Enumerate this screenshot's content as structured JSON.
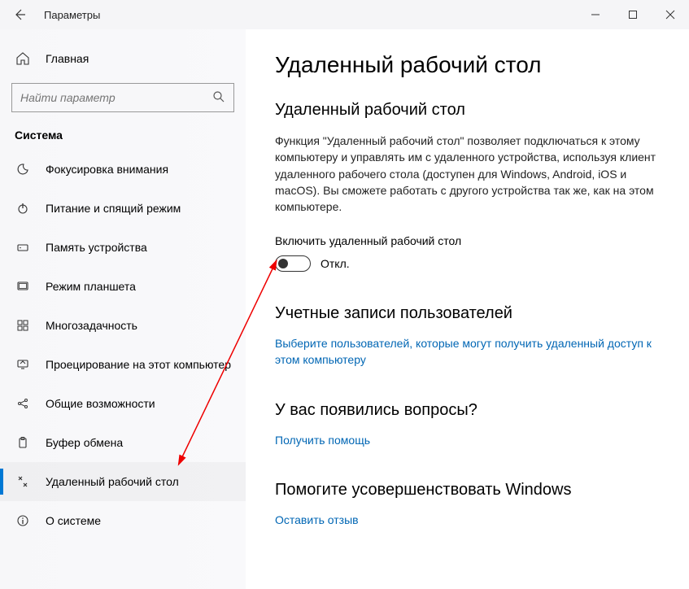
{
  "titlebar": {
    "title": "Параметры"
  },
  "sidebar": {
    "home_label": "Главная",
    "search_placeholder": "Найти параметр",
    "category": "Система",
    "items": [
      {
        "label": "Фокусировка внимания",
        "icon": "moon-icon"
      },
      {
        "label": "Питание и спящий режим",
        "icon": "power-icon"
      },
      {
        "label": "Память устройства",
        "icon": "storage-icon"
      },
      {
        "label": "Режим планшета",
        "icon": "tablet-icon"
      },
      {
        "label": "Многозадачность",
        "icon": "multitask-icon"
      },
      {
        "label": "Проецирование на этот компьютер",
        "icon": "project-icon"
      },
      {
        "label": "Общие возможности",
        "icon": "shared-icon"
      },
      {
        "label": "Буфер обмена",
        "icon": "clipboard-icon"
      },
      {
        "label": "Удаленный рабочий стол",
        "icon": "remote-desktop-icon",
        "selected": true
      },
      {
        "label": "О системе",
        "icon": "info-icon"
      }
    ]
  },
  "main": {
    "page_title": "Удаленный рабочий стол",
    "section_title": "Удаленный рабочий стол",
    "description": "Функция \"Удаленный рабочий стол\" позволяет подключаться к этому компьютеру и управлять им с удаленного устройства, используя клиент удаленного рабочего стола (доступен для Windows, Android, iOS и macOS). Вы сможете работать с другого устройства так же, как на этом компьютере.",
    "toggle_label": "Включить удаленный рабочий стол",
    "toggle_state": "Откл.",
    "accounts_title": "Учетные записи пользователей",
    "accounts_link": "Выберите пользователей, которые могут получить удаленный доступ к этом компьютеру",
    "questions_title": "У вас появились вопросы?",
    "help_link": "Получить помощь",
    "feedback_title": "Помогите усовершенствовать Windows",
    "feedback_link": "Оставить отзыв"
  }
}
